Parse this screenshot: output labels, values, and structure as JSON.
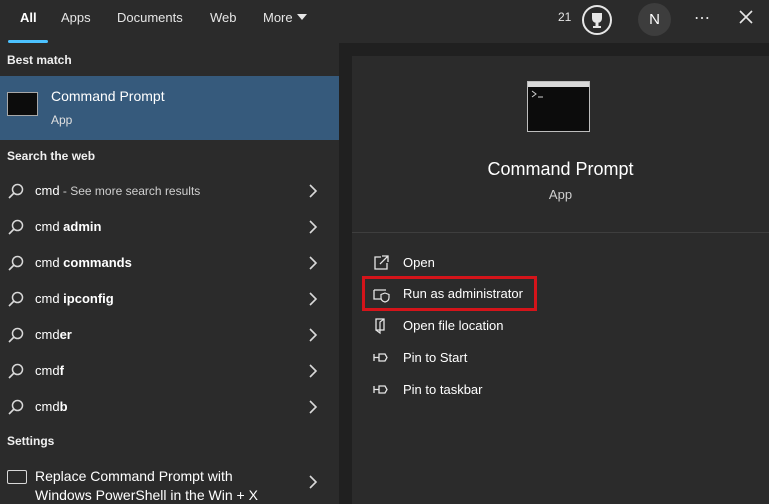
{
  "tabs": [
    {
      "label": "All"
    },
    {
      "label": "Apps"
    },
    {
      "label": "Documents"
    },
    {
      "label": "Web"
    },
    {
      "label": "More"
    }
  ],
  "header": {
    "points": "21",
    "avatar_initial": "N",
    "more_options": "⋯"
  },
  "left": {
    "best_match_title": "Best match",
    "best_match": {
      "title": "Command Prompt",
      "subtitle": "App",
      "icon": "terminal-icon"
    },
    "web_title": "Search the web",
    "web_results": [
      {
        "prefix": "cmd",
        "bold": "",
        "suffix": " - See more search results"
      },
      {
        "prefix": "cmd ",
        "bold": "admin",
        "suffix": ""
      },
      {
        "prefix": "cmd ",
        "bold": "commands",
        "suffix": ""
      },
      {
        "prefix": "cmd ",
        "bold": "ipconfig",
        "suffix": ""
      },
      {
        "prefix": "cmd",
        "bold": "er",
        "suffix": ""
      },
      {
        "prefix": "cmd",
        "bold": "f",
        "suffix": ""
      },
      {
        "prefix": "cmd",
        "bold": "b",
        "suffix": ""
      }
    ],
    "settings_title": "Settings",
    "settings_result": {
      "line1": "Replace Command Prompt with",
      "line2": "Windows PowerShell in the Win + X"
    }
  },
  "right": {
    "app_title": "Command Prompt",
    "app_type": "App",
    "actions": [
      {
        "label": "Open",
        "icon": "open-icon"
      },
      {
        "label": "Run as administrator",
        "icon": "shield-icon"
      },
      {
        "label": "Open file location",
        "icon": "file-location-icon"
      },
      {
        "label": "Pin to Start",
        "icon": "pin-icon"
      },
      {
        "label": "Pin to taskbar",
        "icon": "pin-icon"
      }
    ]
  },
  "colors": {
    "accent": "#4cc2ff",
    "selected": "#365a7c",
    "highlight_border": "#d4141a",
    "panel": "#2b2b2b"
  }
}
